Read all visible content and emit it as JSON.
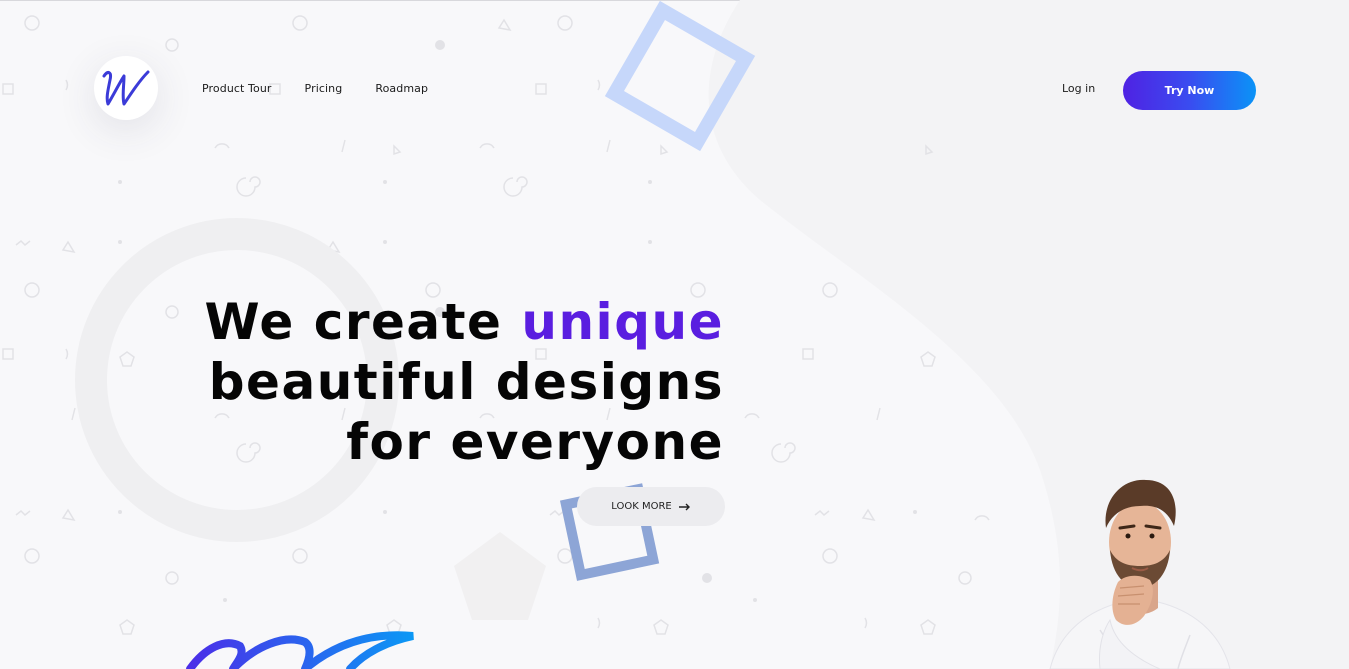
{
  "logo": {
    "icon": "script-w-logo-icon",
    "color": "#3b3bd8"
  },
  "nav": {
    "items": [
      {
        "label": "Product Tour"
      },
      {
        "label": "Pricing"
      },
      {
        "label": "Roadmap"
      }
    ]
  },
  "header": {
    "login_label": "Log in",
    "cta_label": "Try Now"
  },
  "hero": {
    "line1_start": "We create ",
    "line1_accent": "unique",
    "line2": "beautiful designs",
    "line3": "for everyone",
    "button_label": "LOOK MORE",
    "button_icon": "arrow-right-icon"
  },
  "colors": {
    "accent": "#5a1ee0",
    "cta_gradient_start": "#4f22e3",
    "cta_gradient_end": "#0a93f7",
    "background": "#f8f8fa"
  }
}
